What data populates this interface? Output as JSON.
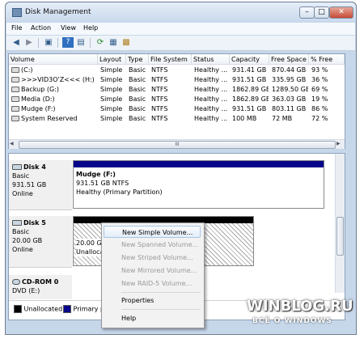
{
  "window": {
    "title": "Disk Management",
    "minimize": "–",
    "maximize": "□",
    "close": "✕"
  },
  "menu": [
    "File",
    "Action",
    "View",
    "Help"
  ],
  "toolbar": {
    "icons": [
      "back-icon",
      "forward-icon",
      "console-icon",
      "help-icon",
      "list-icon",
      "refresh-icon",
      "properties-icon",
      "settings-icon"
    ]
  },
  "volume_table": {
    "columns": [
      "Volume",
      "Layout",
      "Type",
      "File System",
      "Status",
      "Capacity",
      "Free Space",
      "% Free"
    ],
    "rows": [
      [
        "(C:)",
        "Simple",
        "Basic",
        "NTFS",
        "Healthy ...",
        "931.41 GB",
        "870.44 GB",
        "93 %"
      ],
      [
        ">>>VID3O'Z<<< (H:)",
        "Simple",
        "Basic",
        "NTFS",
        "Healthy ...",
        "931.51 GB",
        "335.95 GB",
        "36 %"
      ],
      [
        "Backup  (G:)",
        "Simple",
        "Basic",
        "NTFS",
        "Healthy ...",
        "1862.89 GB",
        "1289.50 GB",
        "69 %"
      ],
      [
        "Media (D:)",
        "Simple",
        "Basic",
        "NTFS",
        "Healthy ...",
        "1862.89 GB",
        "363.03 GB",
        "19 %"
      ],
      [
        "Mudge (F:)",
        "Simple",
        "Basic",
        "NTFS",
        "Healthy ...",
        "931.51 GB",
        "803.11 GB",
        "86 %"
      ],
      [
        "System Reserved",
        "Simple",
        "Basic",
        "NTFS",
        "Healthy ...",
        "100 MB",
        "72 MB",
        "72 %"
      ]
    ],
    "scroll_grip": "III"
  },
  "disks": {
    "disk4": {
      "name": "Disk 4",
      "type": "Basic",
      "size": "931.51 GB",
      "status": "Online",
      "partition": {
        "name": "Mudge  (F:)",
        "detail": "931.51 GB NTFS",
        "health": "Healthy (Primary Partition)"
      }
    },
    "disk5": {
      "name": "Disk 5",
      "type": "Basic",
      "size": "20.00 GB",
      "status": "Online",
      "partition": {
        "size": "20.00 GB",
        "label": "Unalloca"
      }
    },
    "cdrom": {
      "name": "CD-ROM 0",
      "drive": "DVD (E:)"
    }
  },
  "legend": {
    "unallocated": "Unallocated",
    "primary": "Primary p",
    "unallocated_color": "#000000",
    "primary_color": "#07068a"
  },
  "context_menu": {
    "items": [
      "New Simple Volume...",
      "New Spanned Volume...",
      "New Striped Volume...",
      "New Mirrored Volume...",
      "New RAID-5 Volume...",
      "Properties",
      "Help"
    ],
    "highlighted": "New Simple Volume..."
  },
  "watermark": {
    "line1": "WINBLOG.RU",
    "line2": "ВСЁ О WINDOWS"
  }
}
